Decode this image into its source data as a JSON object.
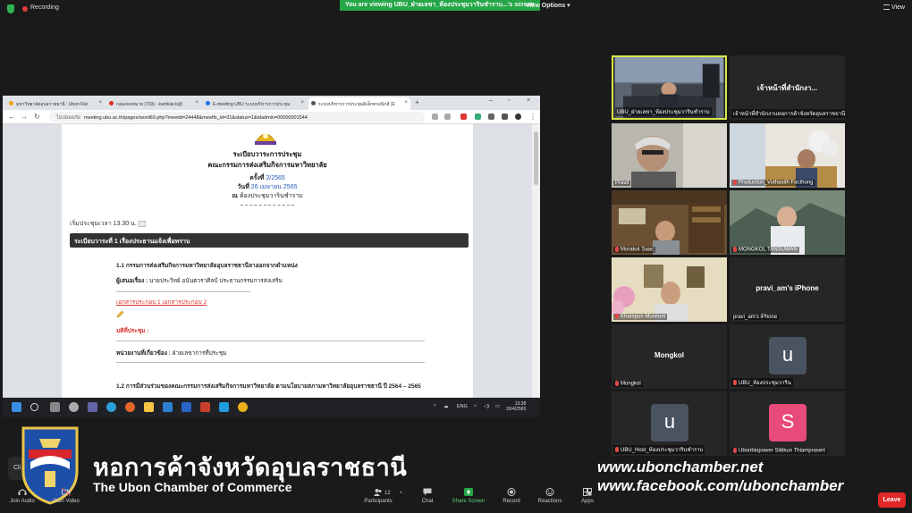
{
  "topbar": {
    "recording_label": "Recording",
    "viewing_banner": "You are viewing UBU_ฝ่ายเลขา_ห้องประชุมวารินชำราบ...'s screen",
    "view_options": "View Options",
    "view_label": "View"
  },
  "browser": {
    "tabs": [
      {
        "label": "มหาวิทยาลัยอุบลราชธานี : Ubon Rat"
      },
      {
        "label": "กล่องจดหมาย (793) - kamkiar.b@"
      },
      {
        "label": "E-meeting UBU ระบบบริหารการประชุม"
      },
      {
        "label": "ระบบบริหารการประชุมอิเล็กทรอนิกส์ (E"
      }
    ],
    "insecure_label": "ไม่ปลอดภัย",
    "url": "meeting.ubu.ac.th/pages/word60.php?meetid=24448&meetfs_id=31&status=1&idadmin=00000001544"
  },
  "document": {
    "title": "ระเบียบวาระการประชุม",
    "committee": "คณะกรรมการส่งเสริมกิจการมหาวิทยาลัย",
    "session_prefix": "ครั้งที่",
    "session": "2/2565",
    "date_prefix": "วันที่",
    "date": "26 เมษายน 2565",
    "place_prefix": "ณ",
    "place": "ห้องประชุมวารินชำราบ",
    "start_time": "เริ่มประชุมเวลา 13.30 น.",
    "agenda_header": "ระเบียบวาระที่ 1 เรื่องประธานแจ้งเพื่อทราบ",
    "item_1_1": "1.1 กรรมการส่งเสริมกิจการมหาวิทยาลัยอุบลราชธานีลาออกจากตำแหน่ง",
    "proposer_label": "ผู้เสนอเรื่อง :",
    "proposer": "นายประวิทย์ อนันตวราศิลป์ ประธานกรรมการส่งเสริม",
    "attachments": "เอกสารประกอบ 1  เอกสารประกอบ 2",
    "resolution_label": "มติที่ประชุม :",
    "responsible_label": "หน่วยงานที่เกี่ยวข้อง :",
    "responsible": "ฝ่ายเลขาการที่ประชุม",
    "item_1_2": "1.2 การมีส่วนร่วมของคณะกรรมการส่งเสริมกิจการมหาวิทยาลัย ตามนโยบายสภามหาวิทยาลัยอุบลราชธานี ปี 2564 – 2565"
  },
  "taskbar": {
    "lang": "ENG",
    "time": "13:38",
    "date": "26/4/2565"
  },
  "gallery": [
    {
      "name": "UBU_ฝ่ายเลขา_ห้องประชุมวารินชำราบ",
      "type": "video",
      "muted": false,
      "active": true
    },
    {
      "name": "เจ้าหน้าที่สำนักงานหอการค้าจังหวัดอุบลราชธานี",
      "display": "เจ้าหน้าที่สำนักงา...",
      "type": "text",
      "muted": false
    },
    {
      "name": "Pravit",
      "type": "video",
      "muted": false
    },
    {
      "name": "Production_Vuthasith Facthong",
      "type": "video",
      "muted": true
    },
    {
      "name": "Morakot Saac",
      "type": "video",
      "muted": true
    },
    {
      "name": "MONGKOL TANSUWAN",
      "type": "video",
      "muted": true
    },
    {
      "name": "Khampun Museum",
      "type": "video",
      "muted": true
    },
    {
      "name": "pravi_am's iPhone",
      "display": "pravi_am's iPhone",
      "type": "text",
      "muted": false
    },
    {
      "name": "Mongkol",
      "display": "Mongkol",
      "type": "text",
      "muted": true
    },
    {
      "name": "UBU_ห้องประชุมวาริน",
      "avatar": "u",
      "avatar_color": "#4a5360",
      "type": "avatar",
      "muted": true
    },
    {
      "name": "UBU_Host_ห้องประชุมวารินชำราบ",
      "avatar": "u",
      "avatar_color": "#4a5360",
      "type": "avatar",
      "muted": true
    },
    {
      "name": "Ubonbiopower Sittikun Thiamprasert",
      "avatar": "S",
      "avatar_color": "#e84a7a",
      "type": "avatar",
      "muted": true
    }
  ],
  "watermark": {
    "thai_name": "หอการค้าจังหวัดอุบลราชธานี",
    "english_name": "The Ubon Chamber of Commerce",
    "website": "www.ubonchamber.net",
    "facebook": "www.facebook.com/ubonchamber"
  },
  "toolbar": {
    "join_audio": "Join Audio",
    "start_video": "Start Video",
    "participants": "Participants",
    "participants_count": "12",
    "chat": "Chat",
    "share_screen": "Share Screen",
    "record": "Record",
    "reactions": "Reactions",
    "apps": "Apps",
    "leave": "Leave",
    "clip_button": "Cli"
  },
  "colors": {
    "share_green": "#26a647",
    "leave_red": "#e02828",
    "active_speaker": "#d9e64b"
  }
}
